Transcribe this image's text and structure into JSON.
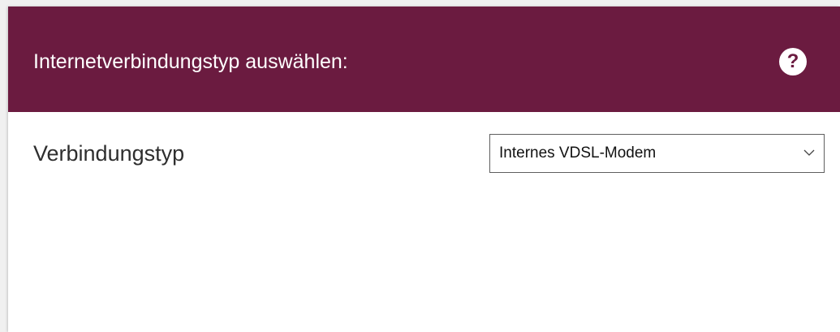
{
  "panel": {
    "title": "Internetverbindungstyp auswählen:",
    "help_icon": "question-circle-icon",
    "help_glyph": "?"
  },
  "field": {
    "label": "Verbindungstyp",
    "selected_value": "Internes VDSL-Modem",
    "chevron_icon": "chevron-down-icon"
  },
  "colors": {
    "header_bg": "#6b1b40",
    "header_text": "#ffffff",
    "body_bg": "#ffffff",
    "label_text": "#2e2e2e",
    "select_border": "#5f5f5f"
  }
}
